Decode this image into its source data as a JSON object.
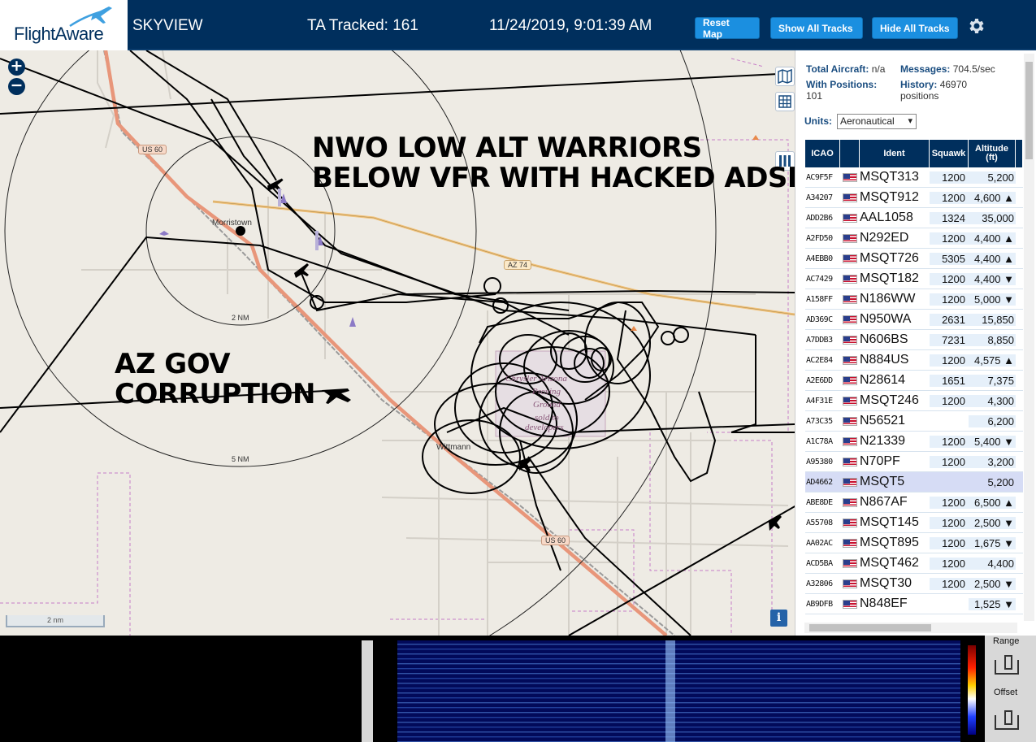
{
  "header": {
    "logo_text": "FlightAware",
    "app_title": "SKYVIEW",
    "tracked": "TA Tracked: 161",
    "datetime": "11/24/2019, 9:01:39 AM",
    "reset_map": "Reset Map",
    "show_all_tracks": "Show All Tracks",
    "hide_all_tracks": "Hide All Tracks",
    "settings_icon": "gear-icon"
  },
  "map": {
    "zoom_in": "+",
    "zoom_out": "−",
    "info": "i",
    "scale": "2 nm",
    "places": {
      "morristown": "Morristown",
      "wittmann": "Wittmann"
    },
    "ring_labels": {
      "inner": "2 NM",
      "outer": "5 NM"
    },
    "roads": {
      "us60_a": "US 60",
      "az74": "AZ 74",
      "us60_b": "US 60"
    },
    "proving_ground": [
      "Chrysler Arizona",
      "Proving",
      "Ground",
      "sold to",
      "developers"
    ],
    "annotations": {
      "nwo_line1": "NWO LOW ALT WARRIORS",
      "nwo_line2": "BELOW VFR WITH HACKED ADSB",
      "az_line1": "AZ GOV",
      "az_line2": "CORRUPTION"
    },
    "colors": {
      "land": "#eeebe4",
      "track": "#000000",
      "highway": "#e8967a",
      "state_road": "#f2c27a",
      "boundary": "#c26fc2"
    }
  },
  "sidebar": {
    "total_aircraft_label": "Total Aircraft:",
    "total_aircraft_value": "n/a",
    "messages_label": "Messages:",
    "messages_value": "704.5/sec",
    "with_positions_label": "With Positions:",
    "with_positions_value": "101",
    "history_label": "History:",
    "history_value": "46970",
    "history_unit": "positions",
    "units_label": "Units:",
    "units_value": "Aeronautical",
    "columns": {
      "icao": "ICAO",
      "ident": "Ident",
      "squawk": "Squawk",
      "altitude": "Altitude (ft)"
    },
    "rows": [
      {
        "icao": "AC9F5F",
        "ident": "MSQT313",
        "squawk": "1200",
        "alt": "5,200"
      },
      {
        "icao": "A34207",
        "ident": "MSQT912",
        "squawk": "1200",
        "alt": "4,600 ▲"
      },
      {
        "icao": "ADD2B6",
        "ident": "AAL1058",
        "squawk": "1324",
        "alt": "35,000"
      },
      {
        "icao": "A2FD50",
        "ident": "N292ED",
        "squawk": "1200",
        "alt": "4,400 ▲"
      },
      {
        "icao": "A4EBB0",
        "ident": "MSQT726",
        "squawk": "5305",
        "alt": "4,400 ▲"
      },
      {
        "icao": "AC7429",
        "ident": "MSQT182",
        "squawk": "1200",
        "alt": "4,400 ▼"
      },
      {
        "icao": "A158FF",
        "ident": "N186WW",
        "squawk": "1200",
        "alt": "5,000 ▼"
      },
      {
        "icao": "AD369C",
        "ident": "N950WA",
        "squawk": "2631",
        "alt": "15,850"
      },
      {
        "icao": "A7DDB3",
        "ident": "N606BS",
        "squawk": "7231",
        "alt": "8,850"
      },
      {
        "icao": "AC2E84",
        "ident": "N884US",
        "squawk": "1200",
        "alt": "4,575 ▲"
      },
      {
        "icao": "A2E6DD",
        "ident": "N28614",
        "squawk": "1651",
        "alt": "7,375"
      },
      {
        "icao": "A4F31E",
        "ident": "MSQT246",
        "squawk": "1200",
        "alt": "4,300"
      },
      {
        "icao": "A73C35",
        "ident": "N56521",
        "squawk": "",
        "alt": "6,200"
      },
      {
        "icao": "A1C78A",
        "ident": "N21339",
        "squawk": "1200",
        "alt": "5,400 ▼"
      },
      {
        "icao": "A95380",
        "ident": "N70PF",
        "squawk": "1200",
        "alt": "3,200"
      },
      {
        "icao": "AD4662",
        "ident": "MSQT5",
        "squawk": "",
        "alt": "5,200"
      },
      {
        "icao": "ABE8DE",
        "ident": "N867AF",
        "squawk": "1200",
        "alt": "6,500 ▲"
      },
      {
        "icao": "A55708",
        "ident": "MSQT145",
        "squawk": "1200",
        "alt": "2,500 ▼"
      },
      {
        "icao": "AA02AC",
        "ident": "MSQT895",
        "squawk": "1200",
        "alt": "1,675 ▼"
      },
      {
        "icao": "ACD5BA",
        "ident": "MSQT462",
        "squawk": "1200",
        "alt": "4,400"
      },
      {
        "icao": "A32806",
        "ident": "MSQT30",
        "squawk": "1200",
        "alt": "2,500 ▼"
      },
      {
        "icao": "AB9DFB",
        "ident": "N848EF",
        "squawk": "",
        "alt": "1,525 ▼"
      }
    ],
    "selected_row_index": 15
  },
  "spectrum": {
    "range_label": "Range",
    "offset_label": "Offset"
  }
}
